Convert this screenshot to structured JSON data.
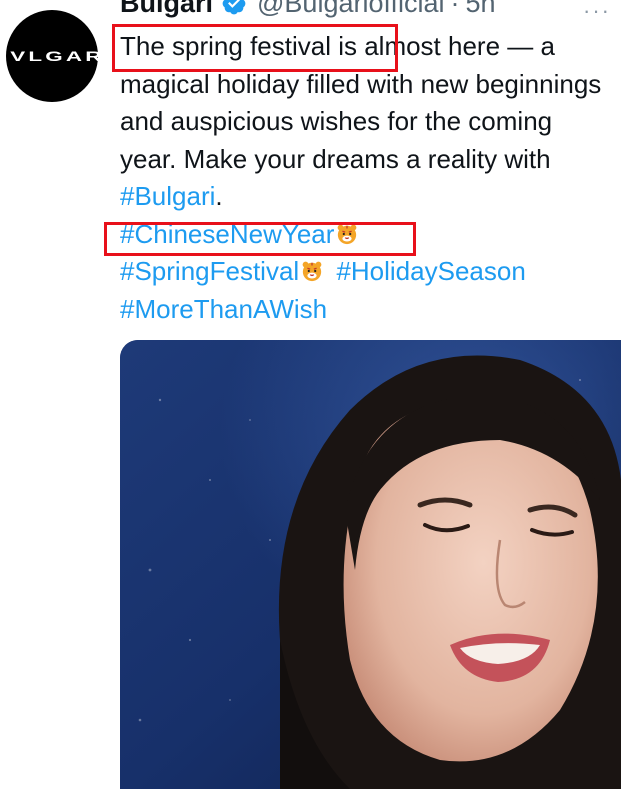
{
  "tweet": {
    "author_name": "Bulgari",
    "handle": "@Bulgariofficial",
    "separator": "·",
    "time": "5h",
    "avatar_logo": "BVLGARI",
    "text_segments": [
      "The spring festival is almost here — a magical holiday filled with new beginnings and auspicious wishes for the coming year. Make your dreams a reality with ",
      "#Bulgari",
      "."
    ],
    "hashtags": {
      "chinese_new_year": "#ChineseNewYear",
      "spring_festival": "#SpringFestival",
      "holiday_season": "#HolidaySeason",
      "more_than_a_wish": "#MoreThanAWish"
    },
    "more_icon": "···"
  },
  "colors": {
    "link": "#1d9bf0",
    "verified": "#1d9bf0",
    "highlight_box": "#e8101a",
    "text": "#0f1419",
    "secondary": "#536471"
  },
  "icons": {
    "verified": "verified-badge-icon",
    "emoji": "tiger-face-emoji",
    "more": "more-options-icon"
  }
}
